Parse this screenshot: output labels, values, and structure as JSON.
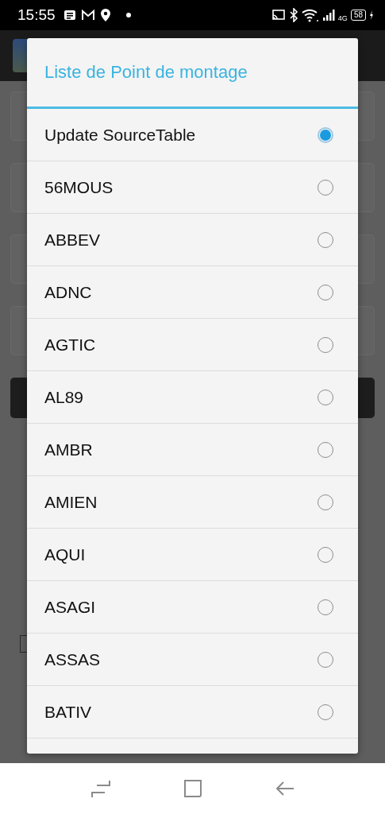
{
  "status_bar": {
    "time": "15:55",
    "network": "4G",
    "battery": "58"
  },
  "background": {
    "checkbox": {
      "checked": false
    }
  },
  "dialog": {
    "title": "Liste de Point de montage",
    "items": [
      {
        "label": "Update SourceTable",
        "selected": true
      },
      {
        "label": "56MOUS",
        "selected": false
      },
      {
        "label": "ABBEV",
        "selected": false
      },
      {
        "label": "ADNC",
        "selected": false
      },
      {
        "label": "AGTIC",
        "selected": false
      },
      {
        "label": "AL89",
        "selected": false
      },
      {
        "label": "AMBR",
        "selected": false
      },
      {
        "label": "AMIEN",
        "selected": false
      },
      {
        "label": "AQUI",
        "selected": false
      },
      {
        "label": "ASAGI",
        "selected": false
      },
      {
        "label": "ASSAS",
        "selected": false
      },
      {
        "label": "BATIV",
        "selected": false
      }
    ]
  }
}
